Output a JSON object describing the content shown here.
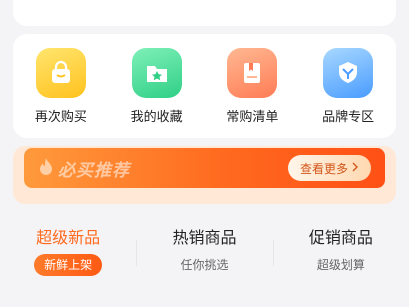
{
  "shortcuts": [
    {
      "label": "再次购买",
      "icon": "shopping-bag-icon",
      "color_from": "#ffe16b",
      "color_to": "#ffc21e"
    },
    {
      "label": "我的收藏",
      "icon": "star-folder-icon",
      "color_from": "#7ff0b8",
      "color_to": "#2fcf86"
    },
    {
      "label": "常购清单",
      "icon": "list-book-icon",
      "color_from": "#ffb892",
      "color_to": "#ff7c55"
    },
    {
      "label": "品牌专区",
      "icon": "shield-badge-icon",
      "color_from": "#a8d8ff",
      "color_to": "#4a9cff"
    }
  ],
  "banner": {
    "title": "必买推荐",
    "button_label": "查看更多",
    "accent": "#ff6a1f"
  },
  "tabs": [
    {
      "title": "超级新品",
      "subtitle": "新鲜上架",
      "active": true
    },
    {
      "title": "热销商品",
      "subtitle": "任你挑选",
      "active": false
    },
    {
      "title": "促销商品",
      "subtitle": "超级划算",
      "active": false
    }
  ]
}
